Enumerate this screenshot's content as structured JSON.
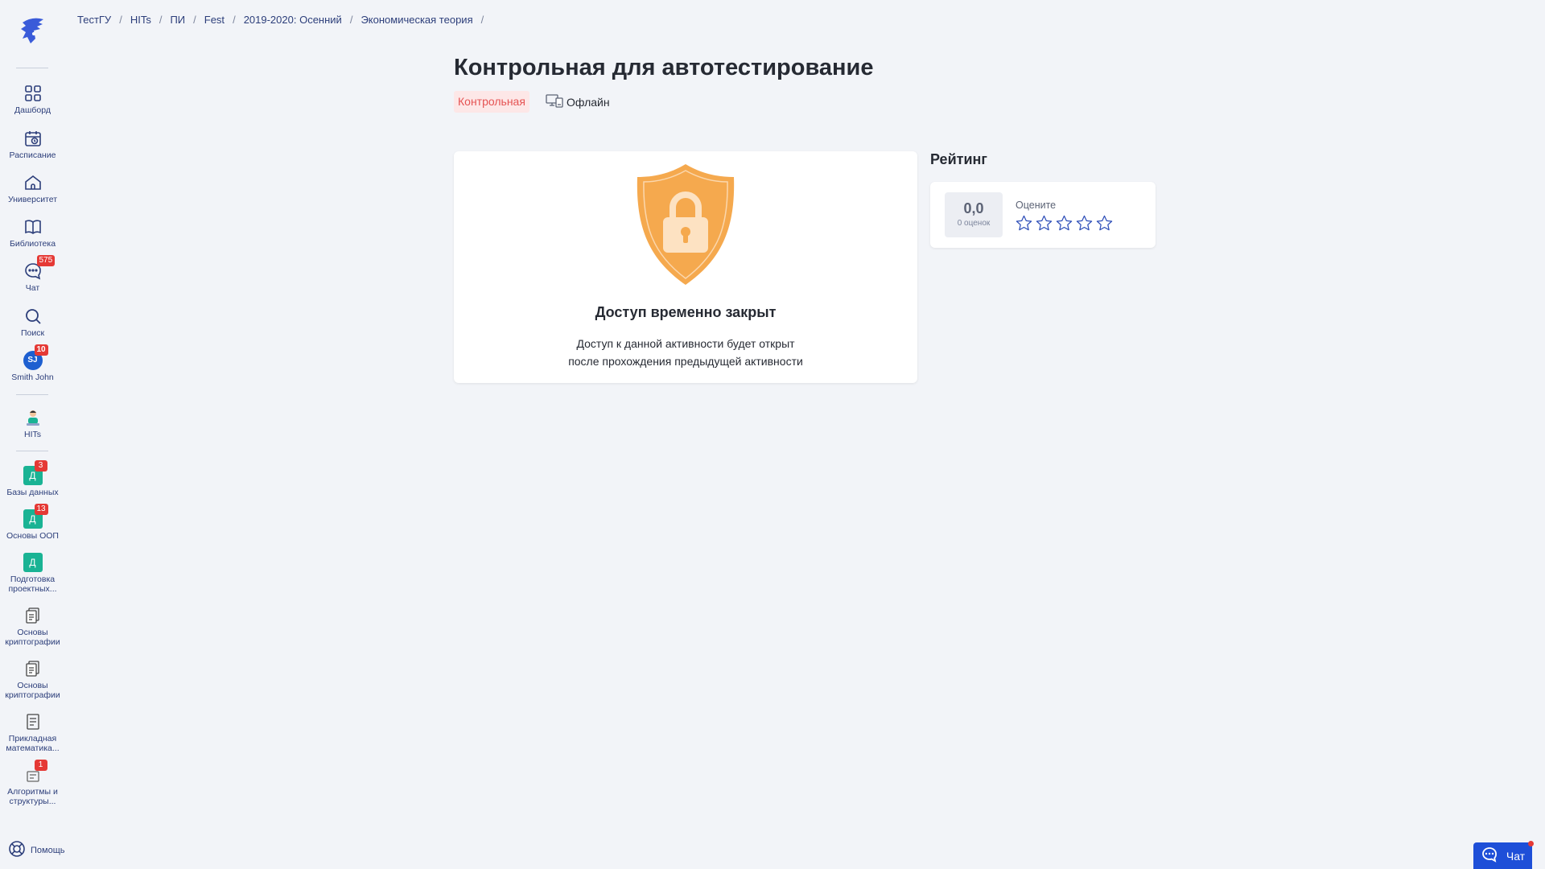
{
  "breadcrumb": [
    "ТестГУ",
    "HITs",
    "ПИ",
    "Fest",
    "2019-2020: Осенний",
    "Экономическая теория"
  ],
  "sidebar": {
    "nav": [
      {
        "label": "Дашборд",
        "icon": "dashboard-icon"
      },
      {
        "label": "Расписание",
        "icon": "calendar-icon"
      },
      {
        "label": "Университет",
        "icon": "university-icon"
      },
      {
        "label": "Библиотека",
        "icon": "book-icon"
      },
      {
        "label": "Чат",
        "icon": "chat-icon",
        "badge": "575"
      },
      {
        "label": "Поиск",
        "icon": "search-icon"
      },
      {
        "label": "Smith John",
        "avatar": "SJ",
        "badge": "10"
      }
    ],
    "group": {
      "label": "HITs",
      "icon": "group-mascot-icon"
    },
    "courses": [
      {
        "label": "Базы данных",
        "letter": "Д",
        "badge": "3"
      },
      {
        "label": "Основы ООП",
        "letter": "Д",
        "badge": "13"
      },
      {
        "label": "Подготовка проектных...",
        "letter": "Д"
      },
      {
        "label": "Основы криптографии",
        "icon": "document-icon"
      },
      {
        "label": "Основы криптографии",
        "icon": "document-icon"
      },
      {
        "label": "Прикладная математика...",
        "icon": "document-icon"
      },
      {
        "label": "Алгоритмы и структуры...",
        "icon": "document-icon",
        "badge": "1"
      }
    ],
    "help_label": "Помощь"
  },
  "page": {
    "title": "Контрольная для автотестирование",
    "type_tag": "Контрольная",
    "mode_tag": "Офлайн"
  },
  "lock": {
    "title": "Доступ временно закрыт",
    "text_line1": "Доступ к данной активности будет открыт",
    "text_line2": "после прохождения предыдущей активности"
  },
  "rating": {
    "title": "Рейтинг",
    "score": "0,0",
    "count": "0 оценок",
    "rate_label": "Оцените",
    "stars_total": 5
  },
  "chat_button": {
    "label": "Чат"
  },
  "colors": {
    "accent": "#1e4fd8",
    "nav_text": "#2c3e7a",
    "badge": "#e53935",
    "course": "#1ab394",
    "shield": "#f5a94e",
    "tag_bg": "#fde7e7",
    "tag_text": "#e55353"
  }
}
